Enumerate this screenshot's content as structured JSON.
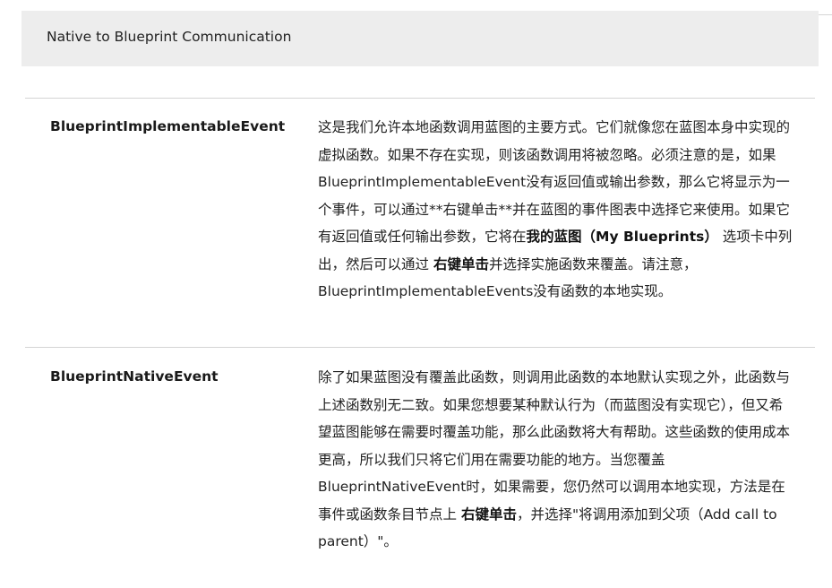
{
  "table": {
    "header": "Native to Blueprint Communication",
    "rows": [
      {
        "term": "BlueprintImplementableEvent",
        "desc": {
          "p1": "这是我们允许本地函数调用蓝图的主要方式。它们就像您在蓝图本身中实现的虚拟函数。如果不存在实现，则该函数调用将被忽略。必须注意的是，如果BlueprintImplementableEvent没有返回值或输出参数，那么它将显示为一个事件，可以通过**右键单击**并在蓝图的事件图表中选择它来使用。如果它有返回值或任何输出参数，它将在",
          "b1": "我的蓝图（My Blueprints）",
          "p2": " 选项卡中列出，然后可以通过 ",
          "b2": "右键单击",
          "p3": "并选择实施函数来覆盖。请注意，BlueprintImplementableEvents没有函数的本地实现。"
        }
      },
      {
        "term": "BlueprintNativeEvent",
        "desc": {
          "p1": "除了如果蓝图没有覆盖此函数，则调用此函数的本地默认实现之外，此函数与上述函数别无二致。如果您想要某种默认行为（而蓝图没有实现它），但又希望蓝图能够在需要时覆盖功能，那么此函数将大有帮助。这些函数的使用成本更高，所以我们只将它们用在需要功能的地方。当您覆盖BlueprintNativeEvent时，如果需要，您仍然可以调用本地实现，方法是在事件或函数条目节点上 ",
          "b1": "右键单击",
          "p2": "，并选择\"将调用添加到父项（Add call to parent）\"。"
        }
      }
    ]
  }
}
